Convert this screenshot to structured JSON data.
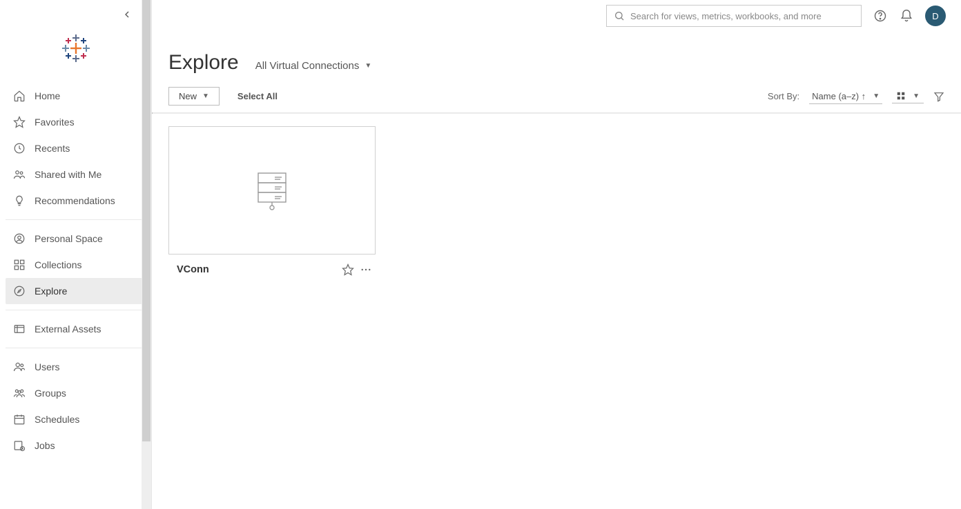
{
  "search": {
    "placeholder": "Search for views, metrics, workbooks, and more"
  },
  "avatar": {
    "initial": "D"
  },
  "sidebar": {
    "sections": [
      {
        "items": [
          {
            "key": "home",
            "label": "Home",
            "icon": "home-icon"
          },
          {
            "key": "favorites",
            "label": "Favorites",
            "icon": "star-icon"
          },
          {
            "key": "recents",
            "label": "Recents",
            "icon": "clock-icon"
          },
          {
            "key": "shared",
            "label": "Shared with Me",
            "icon": "people-icon"
          },
          {
            "key": "recommendations",
            "label": "Recommendations",
            "icon": "bulb-icon"
          }
        ]
      },
      {
        "items": [
          {
            "key": "personal",
            "label": "Personal Space",
            "icon": "person-circle-icon"
          },
          {
            "key": "collections",
            "label": "Collections",
            "icon": "collections-icon"
          },
          {
            "key": "explore",
            "label": "Explore",
            "icon": "compass-icon",
            "active": true
          }
        ]
      },
      {
        "items": [
          {
            "key": "external",
            "label": "External Assets",
            "icon": "external-icon"
          }
        ]
      },
      {
        "items": [
          {
            "key": "users",
            "label": "Users",
            "icon": "users-icon"
          },
          {
            "key": "groups",
            "label": "Groups",
            "icon": "groups-icon"
          },
          {
            "key": "schedules",
            "label": "Schedules",
            "icon": "calendar-icon"
          },
          {
            "key": "jobs",
            "label": "Jobs",
            "icon": "jobs-icon"
          }
        ]
      }
    ]
  },
  "page": {
    "title": "Explore",
    "content_type": "All Virtual Connections"
  },
  "toolbar": {
    "new_label": "New",
    "select_all": "Select All",
    "sort_label": "Sort By:",
    "sort_value": "Name (a–z) ↑"
  },
  "cards": [
    {
      "title": "VConn"
    }
  ]
}
